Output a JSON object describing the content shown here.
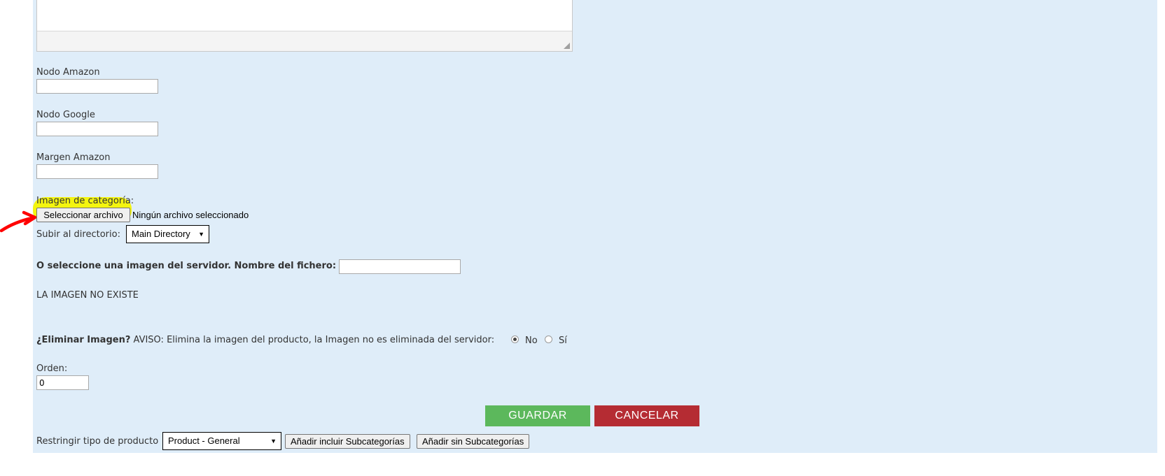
{
  "fields": {
    "nodo_amazon": {
      "label": "Nodo Amazon",
      "value": ""
    },
    "nodo_google": {
      "label": "Nodo Google",
      "value": ""
    },
    "margen_amazon": {
      "label": "Margen Amazon",
      "value": ""
    }
  },
  "image": {
    "label": "Imagen de categoría:",
    "choose_button": "Seleccionar archivo",
    "no_file": "Ningún archivo seleccionado",
    "upload_dir_label": "Subir al directorio:",
    "upload_dir_value": "Main Directory",
    "server_label": "O seleccione una imagen del servidor. Nombre del fichero:",
    "server_value": "",
    "status": "LA IMAGEN NO EXISTE"
  },
  "delete": {
    "question": "¿Eliminar Imagen?",
    "warning": "AVISO: Elimina la imagen del producto, la Imagen no es eliminada del servidor:",
    "options": [
      "No",
      "Sí"
    ],
    "selected": "No"
  },
  "order": {
    "label": "Orden:",
    "value": "0"
  },
  "actions": {
    "save": "GUARDAR",
    "cancel": "CANCELAR"
  },
  "restrict": {
    "label": "Restringir tipo de producto",
    "select_value": "Product - General",
    "add_with_sub": "Añadir incluir Subcategorías",
    "add_without_sub": "Añadir sin Subcategorías"
  },
  "colors": {
    "panel_bg": "#dfedf9",
    "highlight": "#f4f50f",
    "arrow": "#ff0000",
    "save": "#5cb85c",
    "cancel": "#b52c33"
  }
}
